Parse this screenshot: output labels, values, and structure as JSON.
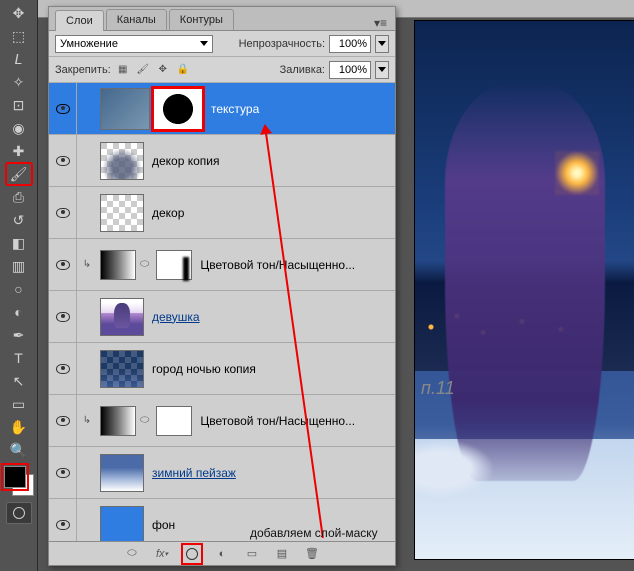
{
  "toolbar": {
    "tools": [
      {
        "name": "move",
        "glyph": "✥"
      },
      {
        "name": "marquee",
        "glyph": "⬚"
      },
      {
        "name": "lasso",
        "glyph": "𝘓"
      },
      {
        "name": "magic-wand",
        "glyph": "✧"
      },
      {
        "name": "crop",
        "glyph": "⊡"
      },
      {
        "name": "eyedropper",
        "glyph": "◉"
      },
      {
        "name": "healing",
        "glyph": "✚"
      },
      {
        "name": "brush",
        "glyph": "🖌",
        "highlighted": true
      },
      {
        "name": "stamp",
        "glyph": "⎙"
      },
      {
        "name": "history-brush",
        "glyph": "↺"
      },
      {
        "name": "eraser",
        "glyph": "◧"
      },
      {
        "name": "gradient",
        "glyph": "▥"
      },
      {
        "name": "blur",
        "glyph": "○"
      },
      {
        "name": "dodge",
        "glyph": "◐"
      },
      {
        "name": "pen",
        "glyph": "✒"
      },
      {
        "name": "type",
        "glyph": "T"
      },
      {
        "name": "path-select",
        "glyph": "↖"
      },
      {
        "name": "shape",
        "glyph": "▭"
      },
      {
        "name": "hand",
        "glyph": "✋"
      },
      {
        "name": "zoom",
        "glyph": "🔍"
      }
    ]
  },
  "panel": {
    "tabs": {
      "layers": "Слои",
      "channels": "Каналы",
      "paths": "Контуры",
      "active": "layers"
    },
    "blend_mode": "Умножение",
    "opacity_label": "Непрозрачность:",
    "opacity_value": "100%",
    "lock_label": "Закрепить:",
    "fill_label": "Заливка:",
    "fill_value": "100%"
  },
  "layers": [
    {
      "id": "l1",
      "name": "текстура",
      "visible": true,
      "active": true,
      "thumb": "ice",
      "mask": "blackmask",
      "mask_highlight": true,
      "linklike": false
    },
    {
      "id": "l2",
      "name": "декор копия",
      "visible": true,
      "thumb": "dekor",
      "linklike": false
    },
    {
      "id": "l3",
      "name": "декор",
      "visible": true,
      "thumb": "checker",
      "linklike": false
    },
    {
      "id": "l4",
      "name": "Цветовой тон/Насыщенно...",
      "visible": true,
      "type": "adjustment",
      "thumb": "hsgrad",
      "mask": "maskedge"
    },
    {
      "id": "l5",
      "name": "девушка",
      "visible": true,
      "thumb": "girl",
      "linklike": true
    },
    {
      "id": "l6",
      "name": "город ночью копия",
      "visible": true,
      "thumb": "nightcity",
      "linklike": false
    },
    {
      "id": "l7",
      "name": "Цветовой тон/Насыщенно...",
      "visible": true,
      "type": "adjustment",
      "thumb": "hsgrad",
      "mask": "white"
    },
    {
      "id": "l8",
      "name": "зимний пейзаж",
      "visible": true,
      "thumb": "winter",
      "linklike": true
    },
    {
      "id": "l9",
      "name": "фон",
      "visible": true,
      "thumb": "blue",
      "linklike": false
    }
  ],
  "footer": {
    "icons": [
      {
        "name": "link",
        "glyph": "⬭"
      },
      {
        "name": "fx",
        "glyph": "fx"
      },
      {
        "name": "add-mask",
        "glyph": "◯",
        "highlight": true
      },
      {
        "name": "adjustment",
        "glyph": "◐"
      },
      {
        "name": "group",
        "glyph": "▭"
      },
      {
        "name": "new-layer",
        "glyph": "▤"
      },
      {
        "name": "delete",
        "glyph": "🗑"
      }
    ]
  },
  "annotation": {
    "text": "добавляем слой-маску"
  },
  "canvas": {
    "step": "п.11"
  }
}
